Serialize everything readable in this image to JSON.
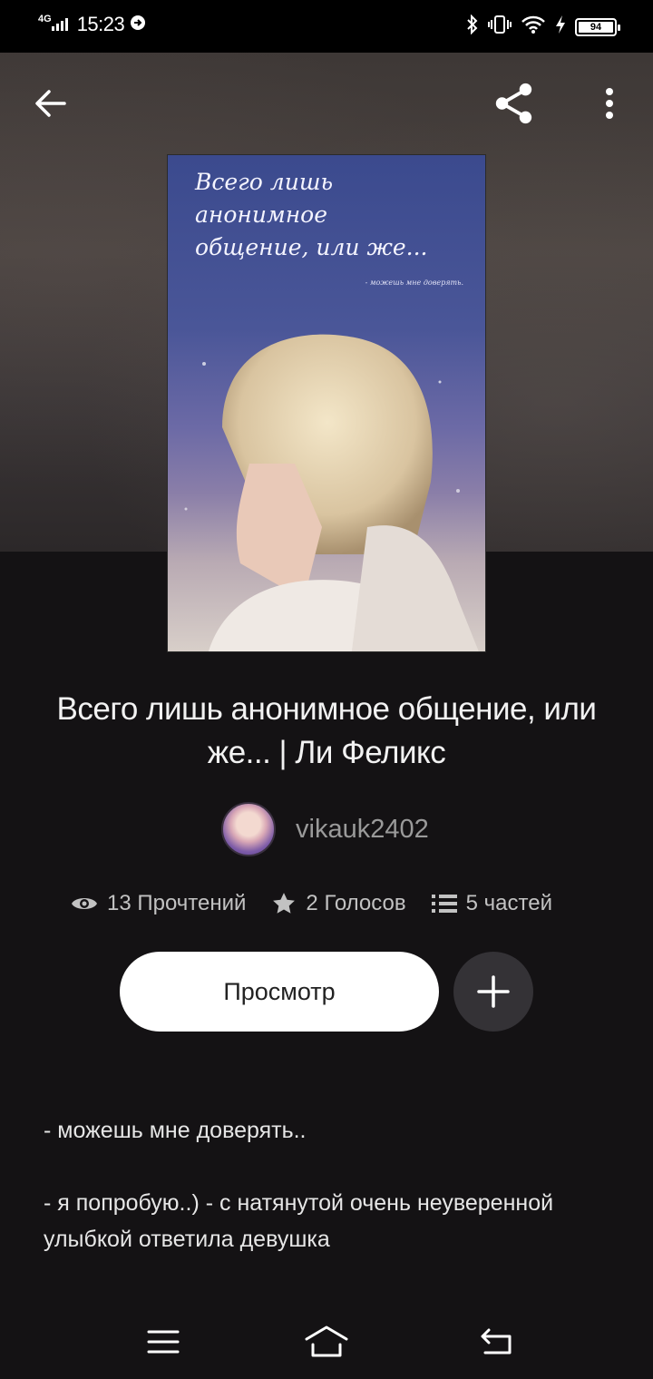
{
  "status_bar": {
    "network": "4G",
    "time": "15:23",
    "battery": "94"
  },
  "book": {
    "cover_title": "Всего лишь\nанонимное\nобщение, или же...",
    "cover_subtitle": "- можешь мне доверять.",
    "title_line1": "Всего лишь анонимное общение, или",
    "title_line2": "же...   | Ли Феликс",
    "author": "vikauk2402"
  },
  "stats": {
    "reads": "13 Прочтений",
    "votes": "2 Голосов",
    "parts": "5 частей"
  },
  "actions": {
    "read_label": "Просмотр"
  },
  "description": [
    "- можешь мне доверять..",
    "- я попробую..) - с натянутой очень неуверенной улыбкой ответила девушка"
  ],
  "icons": {
    "back": "arrow-left-icon",
    "share": "share-icon",
    "more": "more-vertical-icon",
    "reads": "eye-icon",
    "votes": "star-icon",
    "parts": "list-icon",
    "add": "plus-icon",
    "nav_menu": "menu-icon",
    "nav_home": "home-icon",
    "nav_back": "back-icon"
  }
}
